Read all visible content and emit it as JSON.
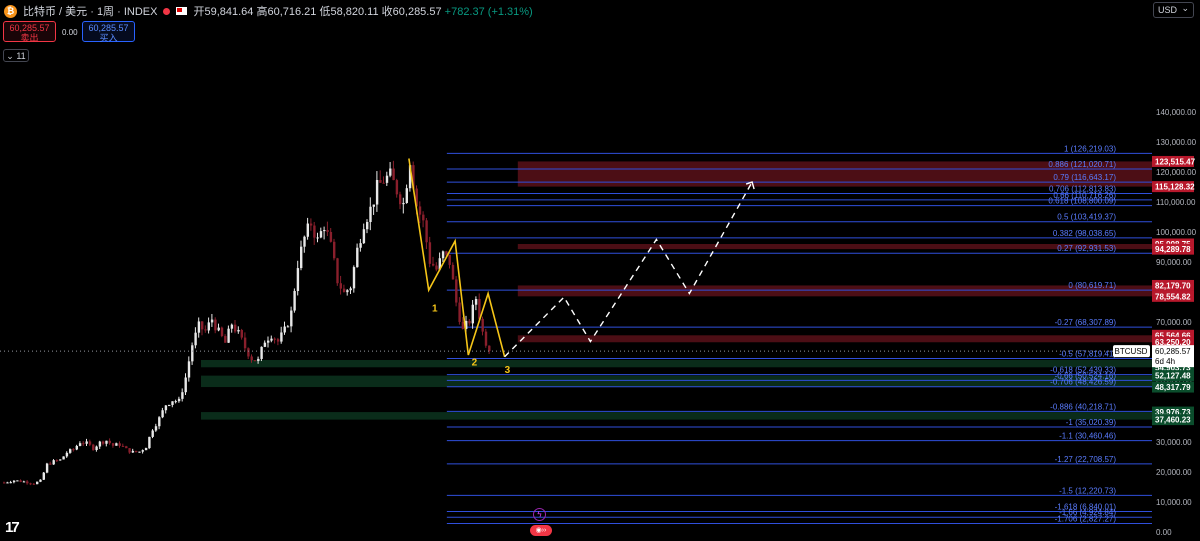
{
  "header": {
    "symbol_title": "比特币 / 美元 · 1周 · INDEX",
    "coin_icon": "bitcoin-icon",
    "open_label": "开",
    "open_value": "59,841.64",
    "high_label": "高",
    "high_value": "60,716.21",
    "low_label": "低",
    "low_value": "58,820.11",
    "close_label": "收",
    "close_value": "60,285.57",
    "change": "+782.37 (+1.31%)"
  },
  "quote": {
    "sell_price": "60,285.57",
    "sell_label": "卖出",
    "spread": "0.00",
    "buy_price": "60,285.57",
    "buy_label": "买入"
  },
  "indicators_toggle": "11",
  "currency_button": "USD",
  "colors": {
    "up": "#e8e8e8",
    "down": "#8a1f2c",
    "fib": "#2f4fdc",
    "wave": "#f5c518",
    "resistance": "#8b1a26",
    "support": "#0d3b23"
  },
  "chart_data": {
    "type": "candlestick",
    "symbol": "BTCUSD",
    "timeframe": "1W",
    "ylim": [
      0,
      145000
    ],
    "y_ticks": [
      0,
      10000,
      20000,
      30000,
      40000,
      50000,
      60000,
      70000,
      80000,
      90000,
      100000,
      110000,
      120000,
      130000,
      140000
    ],
    "y_tick_labels": [
      "0.00",
      "10,000.00",
      "20,000.00",
      "30,000.00",
      "40,000.00",
      "50,000.00",
      "60,000.00",
      "70,000.00",
      "80,000.00",
      "90,000.00",
      "100,000.00",
      "110,000.00",
      "120,000.00",
      "130,000.00",
      "140,000.00"
    ],
    "price_path": [
      [
        0,
        16500
      ],
      [
        3,
        17200
      ],
      [
        6,
        16800
      ],
      [
        9,
        16200
      ],
      [
        11,
        17000
      ],
      [
        13,
        22500
      ],
      [
        15,
        23500
      ],
      [
        17,
        24000
      ],
      [
        19,
        26500
      ],
      [
        21,
        27500
      ],
      [
        23,
        30000
      ],
      [
        25,
        29500
      ],
      [
        27,
        28000
      ],
      [
        29,
        29800
      ],
      [
        31,
        30500
      ],
      [
        33,
        28800
      ],
      [
        35,
        29200
      ],
      [
        37,
        27500
      ],
      [
        39,
        26600
      ],
      [
        41,
        26800
      ],
      [
        43,
        28500
      ],
      [
        45,
        34500
      ],
      [
        47,
        37800
      ],
      [
        49,
        42500
      ],
      [
        51,
        44000
      ],
      [
        53,
        43500
      ],
      [
        55,
        51500
      ],
      [
        57,
        62500
      ],
      [
        59,
        68500
      ],
      [
        61,
        67000
      ],
      [
        63,
        71000
      ],
      [
        65,
        66500
      ],
      [
        67,
        63000
      ],
      [
        69,
        69500
      ],
      [
        71,
        66000
      ],
      [
        73,
        61500
      ],
      [
        75,
        58000
      ],
      [
        77,
        57000
      ],
      [
        79,
        64000
      ],
      [
        81,
        66000
      ],
      [
        83,
        63500
      ],
      [
        85,
        67000
      ],
      [
        87,
        73000
      ],
      [
        89,
        89500
      ],
      [
        91,
        98000
      ],
      [
        93,
        103000
      ],
      [
        95,
        97000
      ],
      [
        97,
        102500
      ],
      [
        99,
        95000
      ],
      [
        101,
        84000
      ],
      [
        103,
        79500
      ],
      [
        105,
        82000
      ],
      [
        107,
        94000
      ],
      [
        109,
        103500
      ],
      [
        111,
        107500
      ],
      [
        113,
        114500
      ],
      [
        115,
        117500
      ],
      [
        117,
        118500
      ],
      [
        119,
        114000
      ],
      [
        121,
        109500
      ],
      [
        123,
        124500
      ],
      [
        125,
        109000
      ],
      [
        127,
        103000
      ],
      [
        129,
        90500
      ],
      [
        131,
        87500
      ],
      [
        133,
        92500
      ],
      [
        135,
        90000
      ],
      [
        137,
        76500
      ],
      [
        139,
        67000
      ],
      [
        141,
        70500
      ],
      [
        143,
        78000
      ],
      [
        145,
        66500
      ],
      [
        147,
        60285.57
      ]
    ],
    "fib_levels": [
      {
        "ratio": "1",
        "price": "126,219.03"
      },
      {
        "ratio": "0.886",
        "price": "121,020.71"
      },
      {
        "ratio": "0.79",
        "price": "116,643.17"
      },
      {
        "ratio": "0.706",
        "price": "112,813.83"
      },
      {
        "ratio": "0.66",
        "price": "110,716.26"
      },
      {
        "ratio": "0.618",
        "price": "108,800.09"
      },
      {
        "ratio": "0.5",
        "price": "103,419.37"
      },
      {
        "ratio": "0.382",
        "price": "98,038.65"
      },
      {
        "ratio": "0.27",
        "price": "92,931.53"
      },
      {
        "ratio": "0",
        "price": "80,619.71"
      },
      {
        "ratio": "-0.27",
        "price": "68,307.89"
      },
      {
        "ratio": "-0.5",
        "price": "57,819.41"
      },
      {
        "ratio": "-0.618",
        "price": "52,439.33"
      },
      {
        "ratio": "-0.66",
        "price": "50,524.16"
      },
      {
        "ratio": "-0.706",
        "price": "48,426.59"
      },
      {
        "ratio": "-0.886",
        "price": "40,218.71"
      },
      {
        "ratio": "-1",
        "price": "35,020.39"
      },
      {
        "ratio": "-1.1",
        "price": "30,460.46"
      },
      {
        "ratio": "-1.27",
        "price": "22,708.57"
      },
      {
        "ratio": "-1.5",
        "price": "12,220.73"
      },
      {
        "ratio": "-1.618",
        "price": "6,840.01"
      },
      {
        "ratio": "-1.66",
        "price": "4,924.84"
      },
      {
        "ratio": "-1.706",
        "price": "2,827.27"
      }
    ],
    "zones": [
      {
        "kind": "resistance",
        "top": 123515.47,
        "bottom": 115128.32
      },
      {
        "kind": "resistance",
        "top": 95998.75,
        "bottom": 94289.78
      },
      {
        "kind": "resistance",
        "top": 82179.7,
        "bottom": 78554.82
      },
      {
        "kind": "resistance",
        "top": 65564.66,
        "bottom": 63250.2
      },
      {
        "kind": "support",
        "top": 57335.93,
        "bottom": 54903.73
      },
      {
        "kind": "support",
        "top": 52127.48,
        "bottom": 48317.79
      },
      {
        "kind": "support",
        "top": 39976.73,
        "bottom": 37460.23
      }
    ],
    "price_tags": [
      {
        "price": 123515.47,
        "text": "123,515.47",
        "kind": "resistance"
      },
      {
        "price": 115128.32,
        "text": "115,128.32",
        "kind": "resistance"
      },
      {
        "price": 95998.75,
        "text": "95,998.75",
        "kind": "resistance"
      },
      {
        "price": 94289.78,
        "text": "94,289.78",
        "kind": "resistance"
      },
      {
        "price": 82179.7,
        "text": "82,179.70",
        "kind": "resistance"
      },
      {
        "price": 78554.82,
        "text": "78,554.82",
        "kind": "resistance"
      },
      {
        "price": 65564.66,
        "text": "65,564.66",
        "kind": "resistance"
      },
      {
        "price": 63250.2,
        "text": "63,250.20",
        "kind": "resistance"
      },
      {
        "price": 57335.93,
        "text": "57,335.93",
        "kind": "support"
      },
      {
        "price": 54903.73,
        "text": "54,903.73",
        "kind": "support"
      },
      {
        "price": 52127.48,
        "text": "52,127.48",
        "kind": "support"
      },
      {
        "price": 48317.79,
        "text": "48,317.79",
        "kind": "support"
      },
      {
        "price": 39976.73,
        "text": "39,976.73",
        "kind": "support"
      },
      {
        "price": 37460.23,
        "text": "37,460.23",
        "kind": "support"
      }
    ],
    "current_price": {
      "price": 60285.57,
      "text": "60,285.57",
      "symbol": "BTCUSD",
      "countdown": "6d 4h"
    },
    "wave_path": [
      [
        123,
        124500
      ],
      [
        129,
        80619
      ],
      [
        137,
        97000
      ],
      [
        141,
        59000
      ],
      [
        147,
        79500
      ],
      [
        152,
        58400
      ]
    ],
    "wave_labels": [
      {
        "text": "1",
        "x": 130,
        "price": 73500
      },
      {
        "text": "2",
        "x": 142,
        "price": 55500
      },
      {
        "text": "3",
        "x": 152,
        "price": 53000
      }
    ],
    "projection_path": [
      [
        152,
        58400
      ],
      [
        170,
        78300
      ],
      [
        178,
        63500
      ],
      [
        198,
        97500
      ],
      [
        208,
        79500
      ],
      [
        227,
        116643
      ]
    ]
  }
}
